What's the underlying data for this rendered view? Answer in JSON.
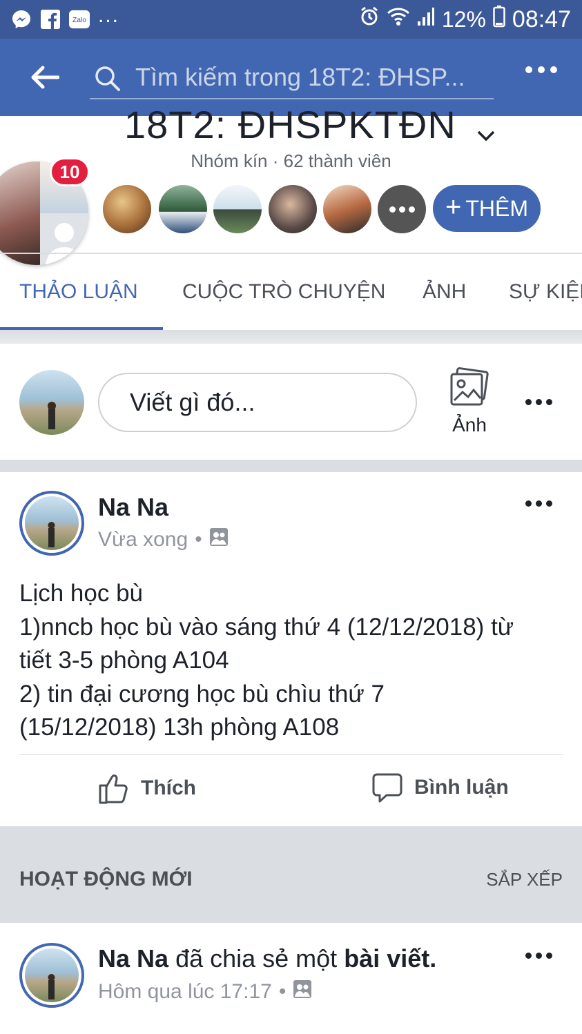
{
  "status_bar": {
    "battery_percent": "12%",
    "time": "08:47",
    "notification_icons": [
      "messenger-icon",
      "facebook-icon",
      "zalo-icon"
    ],
    "zalo_label": "Zalo",
    "more": "..."
  },
  "search": {
    "placeholder": "Tìm kiếm trong 18T2: ĐHSP..."
  },
  "group": {
    "title": "18T2: ĐHSPKTĐN",
    "subtitle": "Nhóm kín · 62 thành viên",
    "notification_count": "10",
    "add_label": "THÊM"
  },
  "tabs": [
    {
      "label": "THẢO LUẬN",
      "active": true
    },
    {
      "label": "CUỘC TRÒ CHUYỆN",
      "active": false
    },
    {
      "label": "ẢNH",
      "active": false
    },
    {
      "label": "SỰ KIỆN",
      "active": false
    }
  ],
  "composer": {
    "placeholder": "Viết gì đó...",
    "photo_label": "Ảnh"
  },
  "post": {
    "author": "Na Na",
    "time": "Vừa xong",
    "lines": [
      "Lịch học bù",
      "1)nncb học bù vào sáng thứ 4 (12/12/2018) từ",
      "tiết 3-5 phòng A104",
      "2) tin đại cương học bù chìu thứ 7",
      "(15/12/2018) 13h phòng A108"
    ],
    "like_label": "Thích",
    "comment_label": "Bình luận"
  },
  "activity": {
    "title": "HOẠT ĐỘNG MỚI",
    "sort_label": "SẮP XẾP"
  },
  "shared_post": {
    "author": "Na Na",
    "action_text": "đã chia sẻ một",
    "object": "bài viết.",
    "time": "Hôm qua lúc 17:17"
  },
  "colors": {
    "header_blue": "#4267b2",
    "statusbar_blue": "#3b5998",
    "badge_red": "#e41e3f"
  }
}
